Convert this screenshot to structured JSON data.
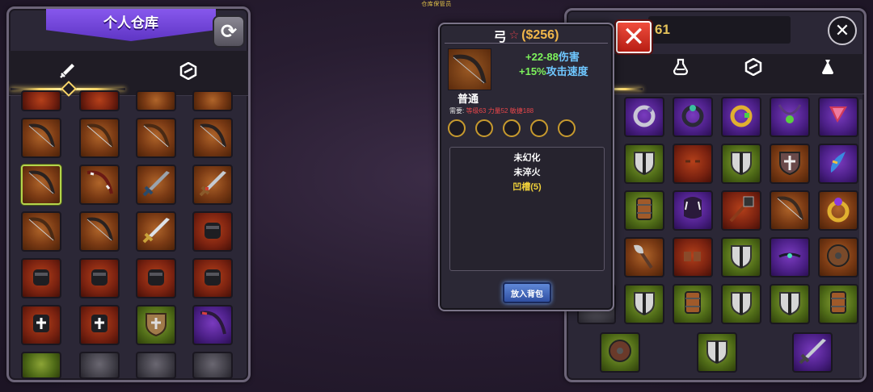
{
  "top_caption": "仓库保管员",
  "left_panel": {
    "title": "个人仓库",
    "refresh_icon": "refresh-icon",
    "tabs": [
      {
        "icon": "sword-icon",
        "active": true
      },
      {
        "icon": "gem-icon",
        "active": false
      }
    ]
  },
  "tooltip": {
    "name": "弓",
    "star": "☆",
    "price": "($256)",
    "stat1_value": "+22-88",
    "stat1_unit": "伤害",
    "stat2_value": "+15%",
    "stat2_unit": "攻击速度",
    "rarity": "普通",
    "requirements": {
      "label": "需要:",
      "level": "等级63",
      "strength": "力量52",
      "agility": "敏捷188"
    },
    "gem_slot_count": 5,
    "properties": [
      {
        "text": "未幻化",
        "color": "#ffffff"
      },
      {
        "text": "未淬火",
        "color": "#ffffff"
      },
      {
        "text": "凹槽(5)",
        "color": "#f1d23a"
      }
    ],
    "button_label": "放入背包"
  },
  "right_panel": {
    "gold_text": "61",
    "close_red_icon": "close-icon",
    "close_dark_icon": "close-icon",
    "tabs": [
      {
        "icon": "potion-icon"
      },
      {
        "icon": "gem-icon"
      },
      {
        "icon": "bag-icon"
      }
    ]
  },
  "colors": {
    "title_ribbon": "#7a4ee6",
    "price": "#f1b64a",
    "stat_green": "#7df25c",
    "stat_blue": "#6fc7ff",
    "requirement_red": "#e8464a",
    "groove_yellow": "#f1d23a",
    "button_blue": "#4a6fc4"
  }
}
